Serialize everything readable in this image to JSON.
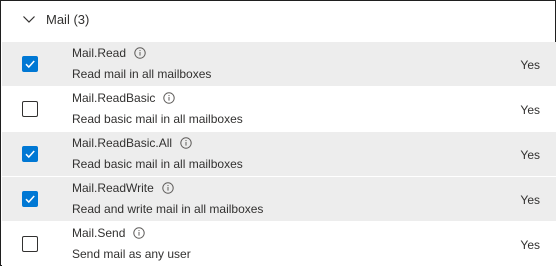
{
  "group": {
    "label": "Mail (3)"
  },
  "permissions": [
    {
      "name": "Mail.Read",
      "description": "Read mail in all mailboxes",
      "admin_consent": "Yes",
      "checked": true
    },
    {
      "name": "Mail.ReadBasic",
      "description": "Read basic mail in all mailboxes",
      "admin_consent": "Yes",
      "checked": false
    },
    {
      "name": "Mail.ReadBasic.All",
      "description": "Read basic mail in all mailboxes",
      "admin_consent": "Yes",
      "checked": true
    },
    {
      "name": "Mail.ReadWrite",
      "description": "Read and write mail in all mailboxes",
      "admin_consent": "Yes",
      "checked": true
    },
    {
      "name": "Mail.Send",
      "description": "Send mail as any user",
      "admin_consent": "Yes",
      "checked": false
    }
  ],
  "colors": {
    "accent": "#0078d4",
    "selected_row": "#ededed"
  },
  "icons": {
    "expand": "chevron-down-icon",
    "info": "info-icon",
    "check": "checkmark-icon"
  }
}
